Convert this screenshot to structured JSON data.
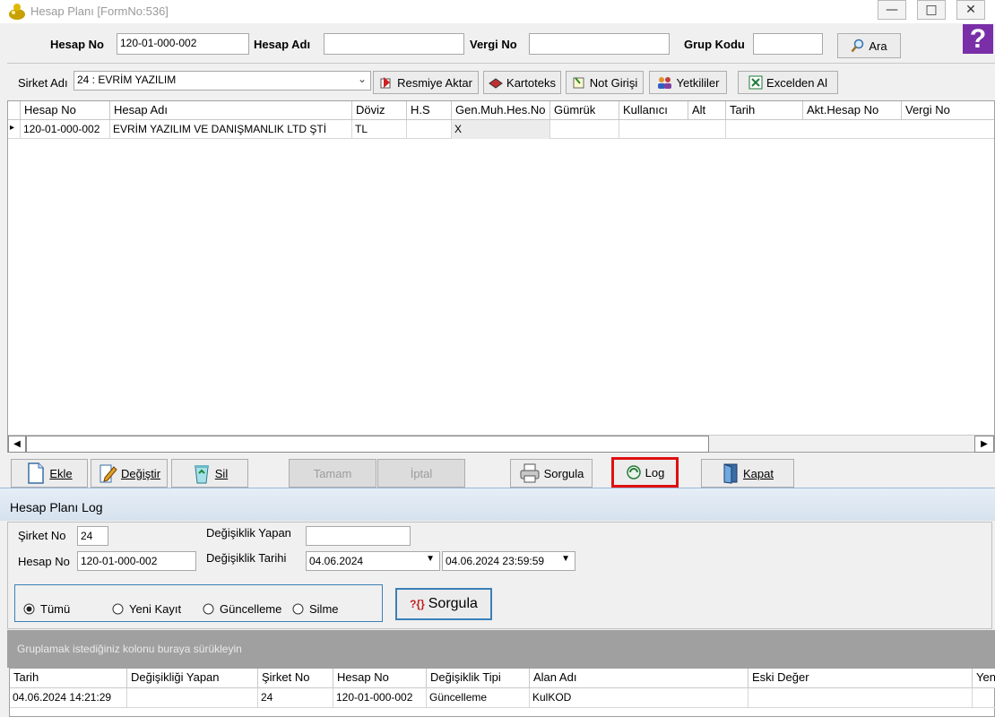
{
  "window": {
    "title": "Hesap Planı [FormNo:536]",
    "help_glyph": "?"
  },
  "search": {
    "hesap_no_label": "Hesap No",
    "hesap_no_value": "120-01-000-002",
    "hesap_adi_label": "Hesap Adı",
    "hesap_adi_value": "",
    "vergi_no_label": "Vergi No",
    "vergi_no_value": "",
    "grup_kodu_label": "Grup Kodu",
    "grup_kodu_value": "",
    "ara_label": "Ara"
  },
  "toolbar": {
    "sirket_label": "Sirket Adı",
    "sirket_value": "24 : EVRİM YAZILIM",
    "buttons": [
      "Resmiye Aktar",
      "Kartoteks",
      "Not Girişi",
      "Yetkililer",
      "Excelden Al"
    ]
  },
  "grid": {
    "columns": [
      "Hesap No",
      "Hesap Adı",
      "Döviz",
      "H.S",
      "Gen.Muh.Hes.No",
      "Gümrük",
      "Kullanıcı",
      "Alt",
      "Tarih",
      "Akt.Hesap No",
      "Vergi No"
    ],
    "rows": [
      [
        "120-01-000-002",
        "EVRİM YAZILIM VE DANIŞMANLIK LTD ŞTİ",
        "TL",
        "",
        "X",
        "",
        "",
        "",
        "",
        "",
        ""
      ]
    ],
    "row_indicator": "▸"
  },
  "actions": {
    "ekle": "Ekle",
    "degistir": "Değiştir",
    "sil": "Sil",
    "tamam": "Tamam",
    "iptal": "İptal",
    "sorgula": "Sorgula",
    "log": "Log",
    "kapat": "Kapat"
  },
  "log_panel": {
    "title": "Hesap Planı Log",
    "sirket_no_label": "Şirket No",
    "sirket_no_value": "24",
    "hesap_no_label": "Hesap No",
    "hesap_no_value": "120-01-000-002",
    "degisiklik_yapan_label": "Değişiklik Yapan",
    "degisiklik_yapan_value": "",
    "degisiklik_tarihi_label": "Değişiklik Tarihi",
    "tarih_from": "04.06.2024",
    "tarih_to": "04.06.2024 23:59:59",
    "radios": [
      "Tümü",
      "Yeni Kayıt",
      "Güncelleme",
      "Silme"
    ],
    "selected_radio": "Tümü",
    "sorgula_label": "Sorgula",
    "group_hint": "Gruplamak istediğiniz kolonu buraya sürükleyin",
    "columns": [
      "Tarih",
      "Değişikliği Yapan",
      "Şirket No",
      "Hesap No",
      "Değişiklik Tipi",
      "Alan Adı",
      "Eski Değer",
      "Yeni"
    ],
    "rows": [
      [
        "04.06.2024 14:21:29",
        "",
        "24",
        "120-01-000-002",
        "Güncelleme",
        "KulKOD",
        "",
        ""
      ]
    ]
  },
  "colors": {
    "highlight_border": "#e01010",
    "log_header_bg": "#dde8f3",
    "group_bar_bg": "#a0a0a0"
  }
}
